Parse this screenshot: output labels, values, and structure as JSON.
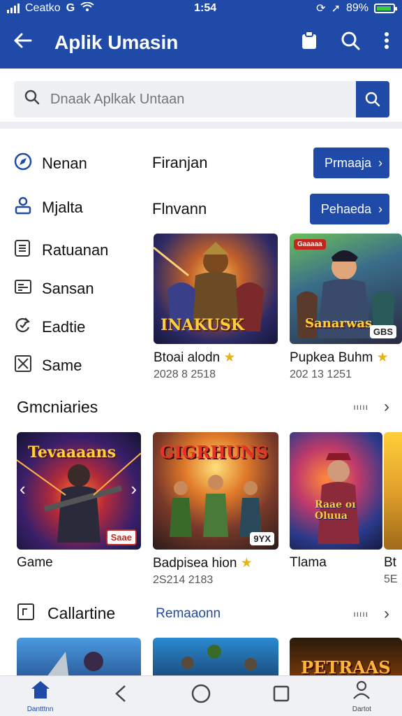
{
  "status": {
    "carrier": "Ceatko",
    "time": "1:54",
    "battery": "89%"
  },
  "appbar": {
    "title": "Aplik Umasin"
  },
  "search": {
    "placeholder": "Dnaak Aplkak Untaan"
  },
  "menu": [
    {
      "label": "Nenan",
      "icon": "compass-icon"
    },
    {
      "label": "Mjalta",
      "icon": "user-icon"
    },
    {
      "label": "Ratuanan",
      "icon": "list-icon"
    },
    {
      "label": "Sansan",
      "icon": "card-icon"
    },
    {
      "label": "Eadtie",
      "icon": "refresh-icon"
    },
    {
      "label": "Same",
      "icon": "close-box-icon"
    }
  ],
  "promos": [
    {
      "label": "Firanjan",
      "button": "Prmaaja"
    },
    {
      "label": "Flnvann",
      "button": "Pehaeda"
    }
  ],
  "featured": [
    {
      "name": "Btoai alodn",
      "meta": "2028 8 2518",
      "art": "INAKUSK"
    },
    {
      "name": "Pupkea Buhm",
      "meta": "202 13 1251",
      "art": "Sanarwas",
      "tag": "Gaaaaa",
      "badge": "GBS"
    }
  ],
  "section1": {
    "title": "Gmcniaries",
    "more": "ııııı",
    "cards": [
      {
        "name": "Game",
        "meta": "",
        "art": "Tevaaaans",
        "badge": "Saae"
      },
      {
        "name": "Badpisea hion",
        "meta": "2S214 2183",
        "art": "GIGRHUNS",
        "badge": "9YX"
      },
      {
        "name": "Tlama",
        "meta": "",
        "art": "Raae oı Oluua"
      },
      {
        "name": "Bt",
        "meta": "5E"
      }
    ]
  },
  "section2": {
    "title": "Callartine",
    "link": "Remaaonn",
    "more": "ııııı",
    "cards": [
      {
        "art": ""
      },
      {
        "art": ""
      },
      {
        "art": "PETRAAS"
      }
    ]
  },
  "bottomnav": [
    {
      "icon": "home-icon",
      "label": "Dantttnn",
      "active": true
    },
    {
      "icon": "back-icon",
      "label": ""
    },
    {
      "icon": "circle-home-icon",
      "label": ""
    },
    {
      "icon": "square-recent-icon",
      "label": ""
    },
    {
      "icon": "profile-icon",
      "label": "Dartot"
    }
  ]
}
